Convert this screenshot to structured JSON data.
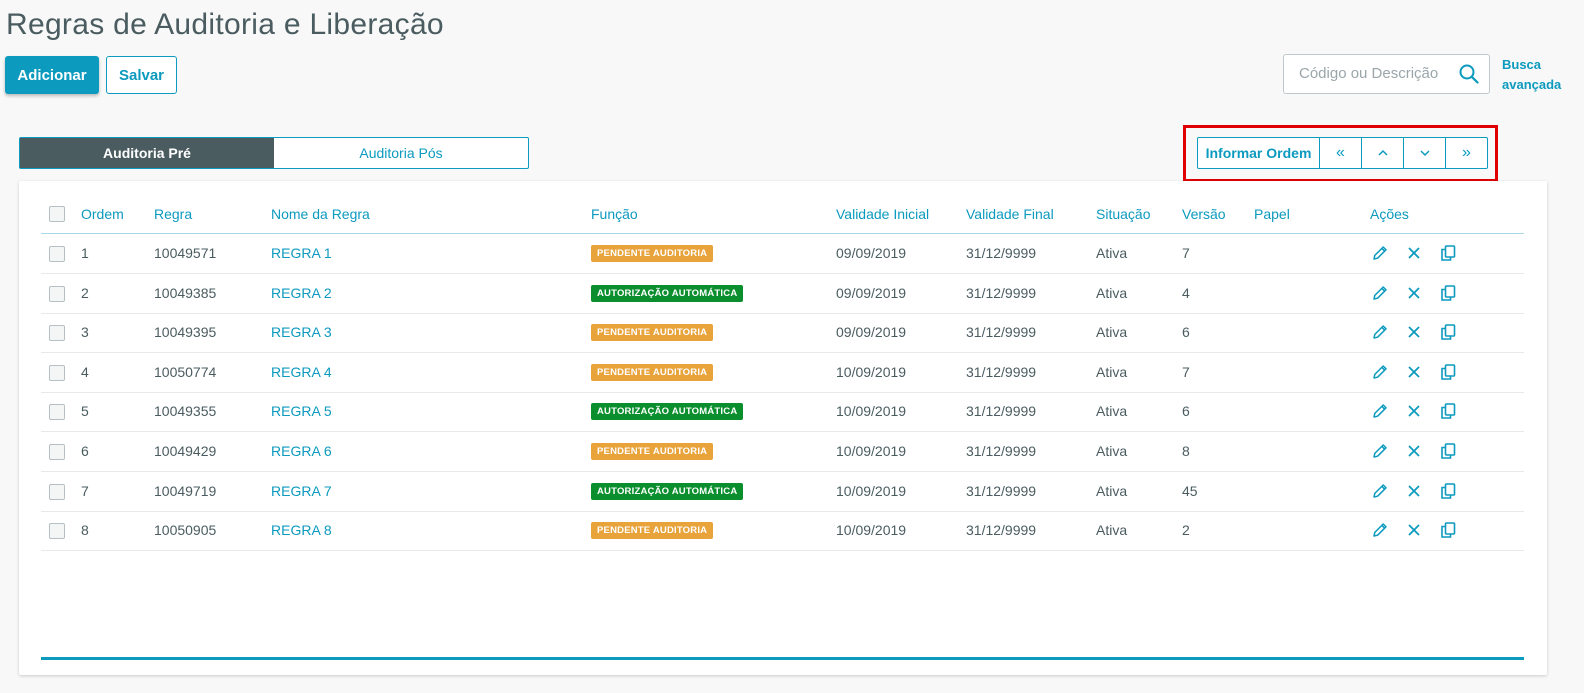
{
  "page": {
    "title": "Regras de Auditoria e Liberação"
  },
  "toolbar": {
    "add_label": "Adicionar",
    "save_label": "Salvar"
  },
  "search": {
    "placeholder": "Código ou Descrição",
    "value": "",
    "advanced_line1": "Busca",
    "advanced_line2": "avançada"
  },
  "tabs": [
    {
      "label": "Auditoria Pré",
      "active": true
    },
    {
      "label": "Auditoria Pós",
      "active": false
    }
  ],
  "order_controls": {
    "inform_label": "Informar Ordem",
    "first_glyph": "«",
    "up_glyph": "⌃",
    "down_glyph": "⌄",
    "last_glyph": "»"
  },
  "table": {
    "columns": [
      "Ordem",
      "Regra",
      "Nome da Regra",
      "Função",
      "Validade Inicial",
      "Validade Final",
      "Situação",
      "Versão",
      "Papel",
      "Ações"
    ],
    "rows": [
      {
        "ordem": "1",
        "regra": "10049571",
        "nome": "REGRA 1",
        "funcao": "PENDENTE AUDITORIA",
        "funcao_type": "pend",
        "validade_inicial": "09/09/2019",
        "validade_final": "31/12/9999",
        "situacao": "Ativa",
        "versao": "7",
        "papel": ""
      },
      {
        "ordem": "2",
        "regra": "10049385",
        "nome": "REGRA 2",
        "funcao": "AUTORIZAÇÃO AUTOMÁTICA",
        "funcao_type": "auto",
        "validade_inicial": "09/09/2019",
        "validade_final": "31/12/9999",
        "situacao": "Ativa",
        "versao": "4",
        "papel": ""
      },
      {
        "ordem": "3",
        "regra": "10049395",
        "nome": "REGRA 3",
        "funcao": "PENDENTE AUDITORIA",
        "funcao_type": "pend",
        "validade_inicial": "09/09/2019",
        "validade_final": "31/12/9999",
        "situacao": "Ativa",
        "versao": "6",
        "papel": ""
      },
      {
        "ordem": "4",
        "regra": "10050774",
        "nome": "REGRA 4",
        "funcao": "PENDENTE AUDITORIA",
        "funcao_type": "pend",
        "validade_inicial": "10/09/2019",
        "validade_final": "31/12/9999",
        "situacao": "Ativa",
        "versao": "7",
        "papel": ""
      },
      {
        "ordem": "5",
        "regra": "10049355",
        "nome": "REGRA 5",
        "funcao": "AUTORIZAÇÃO AUTOMÁTICA",
        "funcao_type": "auto",
        "validade_inicial": "10/09/2019",
        "validade_final": "31/12/9999",
        "situacao": "Ativa",
        "versao": "6",
        "papel": ""
      },
      {
        "ordem": "6",
        "regra": "10049429",
        "nome": "REGRA 6",
        "funcao": "PENDENTE AUDITORIA",
        "funcao_type": "pend",
        "validade_inicial": "10/09/2019",
        "validade_final": "31/12/9999",
        "situacao": "Ativa",
        "versao": "8",
        "papel": ""
      },
      {
        "ordem": "7",
        "regra": "10049719",
        "nome": "REGRA 7",
        "funcao": "AUTORIZAÇÃO AUTOMÁTICA",
        "funcao_type": "auto",
        "validade_inicial": "10/09/2019",
        "validade_final": "31/12/9999",
        "situacao": "Ativa",
        "versao": "45",
        "papel": ""
      },
      {
        "ordem": "8",
        "regra": "10050905",
        "nome": "REGRA 8",
        "funcao": "PENDENTE AUDITORIA",
        "funcao_type": "pend",
        "validade_inicial": "10/09/2019",
        "validade_final": "31/12/9999",
        "situacao": "Ativa",
        "versao": "2",
        "papel": ""
      }
    ],
    "row_actions": [
      "edit-icon",
      "close-icon",
      "copy-icon"
    ]
  },
  "colors": {
    "primary": "#0c9abe",
    "tab_active": "#4a5c60",
    "badge_pending": "#e8a33a",
    "badge_auto": "#0b8f2e",
    "highlight": "#e00000"
  }
}
